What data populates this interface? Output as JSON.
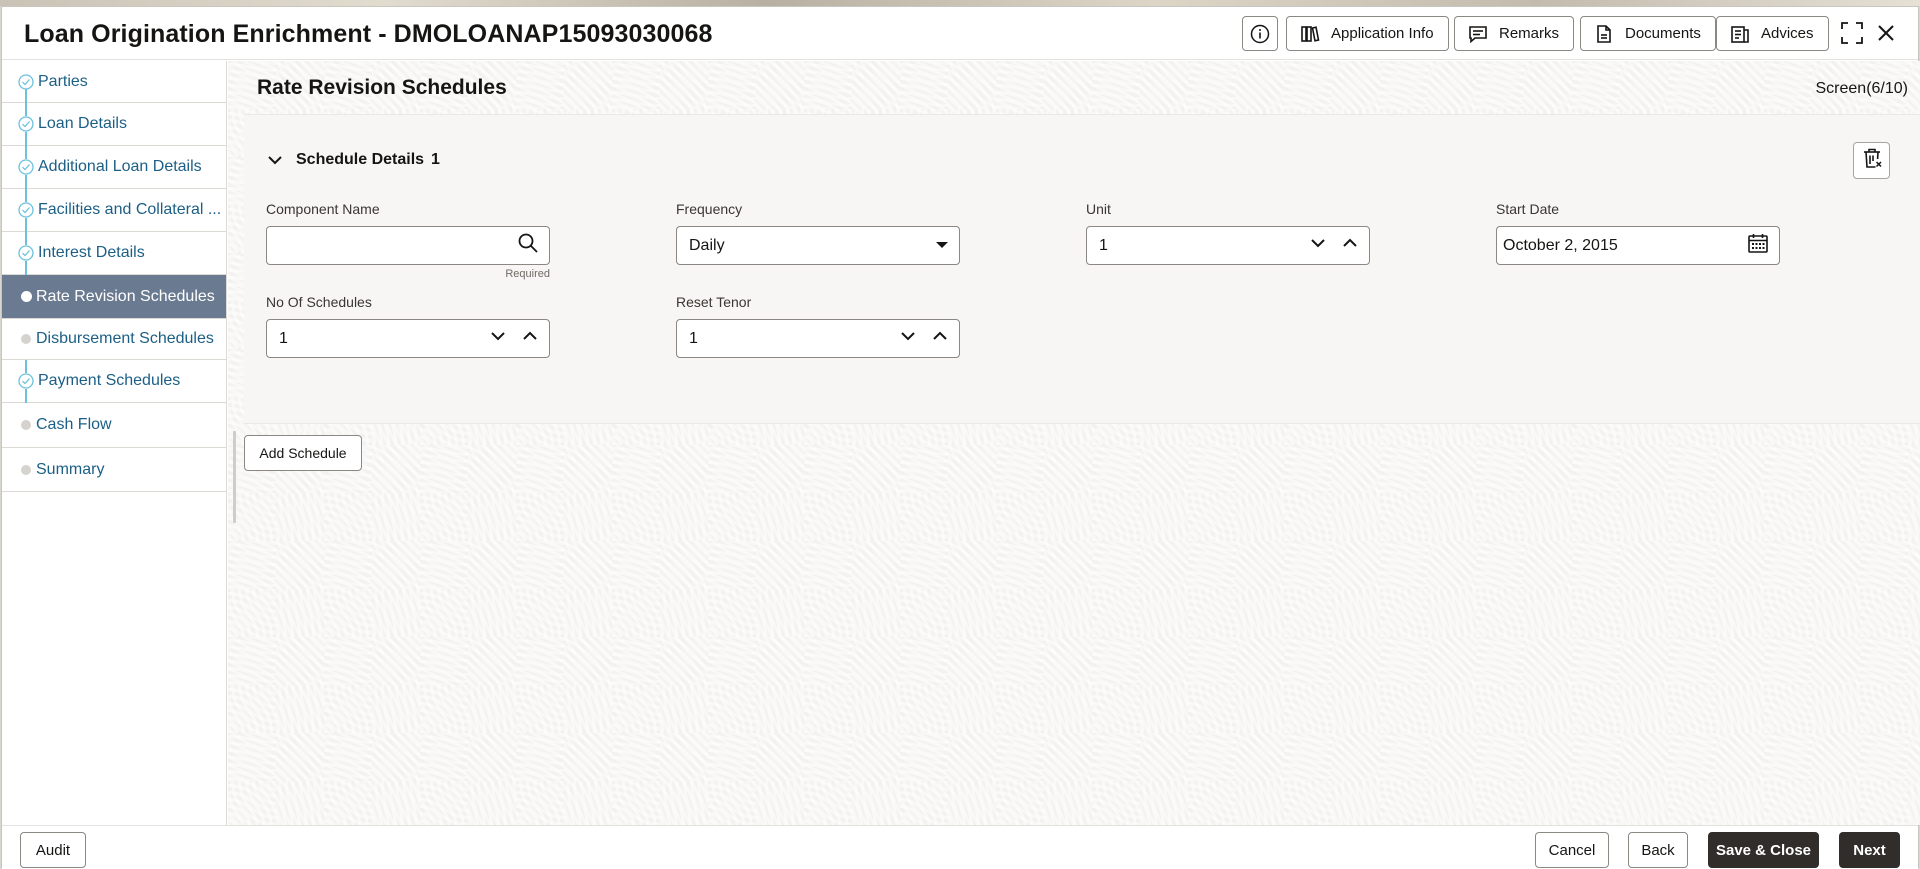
{
  "header": {
    "title": "Loan Origination Enrichment - DMOLOANAP15093030068",
    "buttons": {
      "application_info": "Application Info",
      "remarks": "Remarks",
      "documents": "Documents",
      "advices": "Advices"
    }
  },
  "sidebar": {
    "items": [
      {
        "label": "Parties",
        "status": "complete"
      },
      {
        "label": "Loan Details",
        "status": "complete"
      },
      {
        "label": "Additional Loan Details",
        "status": "complete"
      },
      {
        "label": "Facilities and Collateral ...",
        "status": "complete"
      },
      {
        "label": "Interest Details",
        "status": "complete"
      },
      {
        "label": "Rate Revision Schedules",
        "status": "active"
      },
      {
        "label": "Disbursement Schedules",
        "status": "pending"
      },
      {
        "label": "Payment Schedules",
        "status": "complete"
      },
      {
        "label": "Cash Flow",
        "status": "pending"
      },
      {
        "label": "Summary",
        "status": "pending"
      }
    ]
  },
  "main": {
    "page_title": "Rate Revision Schedules",
    "screen_indicator": "Screen(6/10)",
    "section": {
      "title": "Schedule Details",
      "index": "1"
    },
    "fields": {
      "component_name": {
        "label": "Component Name",
        "value": "",
        "hint": "Required"
      },
      "frequency": {
        "label": "Frequency",
        "value": "Daily"
      },
      "unit": {
        "label": "Unit",
        "value": "1"
      },
      "start_date": {
        "label": "Start Date",
        "value": "October 2, 2015"
      },
      "no_of_schedules": {
        "label": "No Of Schedules",
        "value": "1"
      },
      "reset_tenor": {
        "label": "Reset Tenor",
        "value": "1"
      }
    },
    "add_schedule_label": "Add Schedule"
  },
  "footer": {
    "audit": "Audit",
    "cancel": "Cancel",
    "back": "Back",
    "save_close": "Save & Close",
    "next": "Next"
  },
  "colors": {
    "link": "#1c5f86",
    "active_sidebar": "#6a7a90",
    "progress_line": "#6cc1de",
    "primary_button": "#312d2a"
  }
}
